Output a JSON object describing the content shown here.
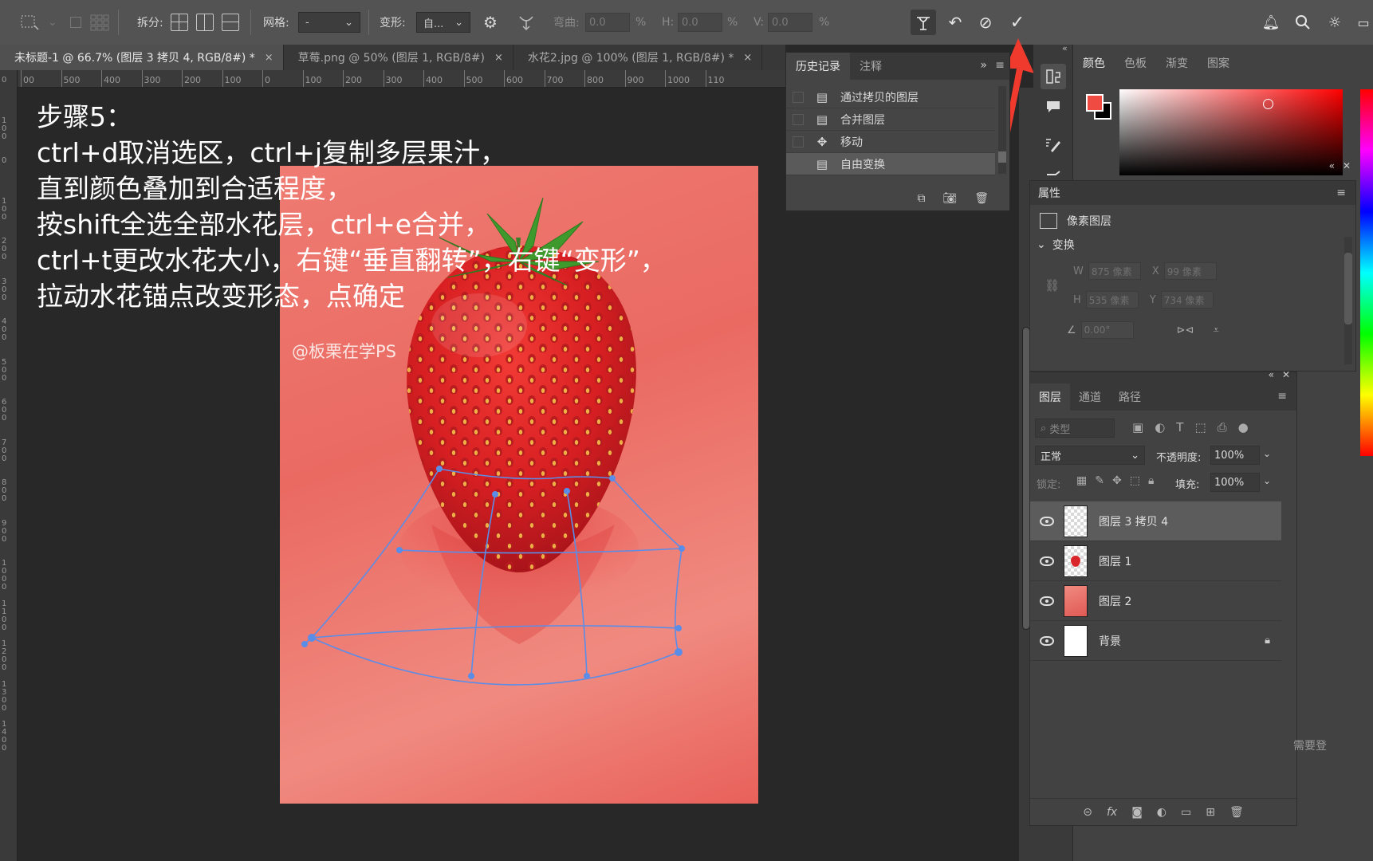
{
  "options_bar": {
    "split_label": "拆分:",
    "grid_label": "网格:",
    "grid_value": "-",
    "warp_label": "变形:",
    "warp_value": "自...",
    "bend_label": "弯曲:",
    "bend_value": "0.0",
    "h_label": "H:",
    "h_value": "0.0",
    "v_label": "V:",
    "v_value": "0.0",
    "percent": "%"
  },
  "tabs": [
    {
      "label": "未标题-1 @ 66.7% (图层 3 拷贝 4, RGB/8#) *",
      "close": "×"
    },
    {
      "label": "草莓.png @ 50% (图层 1, RGB/8#)",
      "close": "×"
    },
    {
      "label": "水花2.jpg @ 100% (图层 1, RGB/8#) *",
      "close": "×"
    }
  ],
  "ruler_h": [
    "00",
    "500",
    "400",
    "300",
    "200",
    "100",
    "0",
    "100",
    "200",
    "300",
    "400",
    "500",
    "600",
    "700",
    "800",
    "900",
    "1000",
    "110"
  ],
  "ruler_v": [
    "0",
    "100",
    "0",
    "100",
    "200",
    "300",
    "400",
    "500",
    "600",
    "700",
    "800",
    "900",
    "1000",
    "1100",
    "1200",
    "1300",
    "1400"
  ],
  "instructions": [
    "步骤5：",
    "ctrl+d取消选区，ctrl+j复制多层果汁，",
    "直到颜色叠加到合适程度，",
    "按shift全选全部水花层，ctrl+e合并，",
    "ctrl+t更改水花大小，右键“垂直翻转”，右键“变形”，",
    "拉动水花锚点改变形态，点确定"
  ],
  "watermark": "@板栗在学PS",
  "history": {
    "tabs": [
      "历史记录",
      "注释"
    ],
    "items": [
      "通过拷贝的图层",
      "合并图层",
      "移动",
      "自由变换"
    ]
  },
  "color_panel": {
    "tabs": [
      "颜色",
      "色板",
      "渐变",
      "图案"
    ],
    "fg_color": "#ef4b42",
    "bg_color": "#000000"
  },
  "properties": {
    "title": "属性",
    "layer_type": "像素图层",
    "section": "变换",
    "w_label": "W",
    "w_value": "875 像素",
    "x_label": "X",
    "x_value": "99 像素",
    "h_label": "H",
    "h_value": "535 像素",
    "y_label": "Y",
    "y_value": "734 像素",
    "angle_value": "0.00°"
  },
  "layers": {
    "tabs": [
      "图层",
      "通道",
      "路径"
    ],
    "filter_placeholder": "类型",
    "blend_mode": "正常",
    "opacity_label": "不透明度:",
    "opacity_value": "100%",
    "lock_label": "锁定:",
    "fill_label": "填充:",
    "fill_value": "100%",
    "items": [
      {
        "name": "图层 3 拷贝 4"
      },
      {
        "name": "图层 1"
      },
      {
        "name": "图层 2"
      },
      {
        "name": "背景"
      }
    ]
  },
  "misc": {
    "login_hint": "需要登"
  }
}
